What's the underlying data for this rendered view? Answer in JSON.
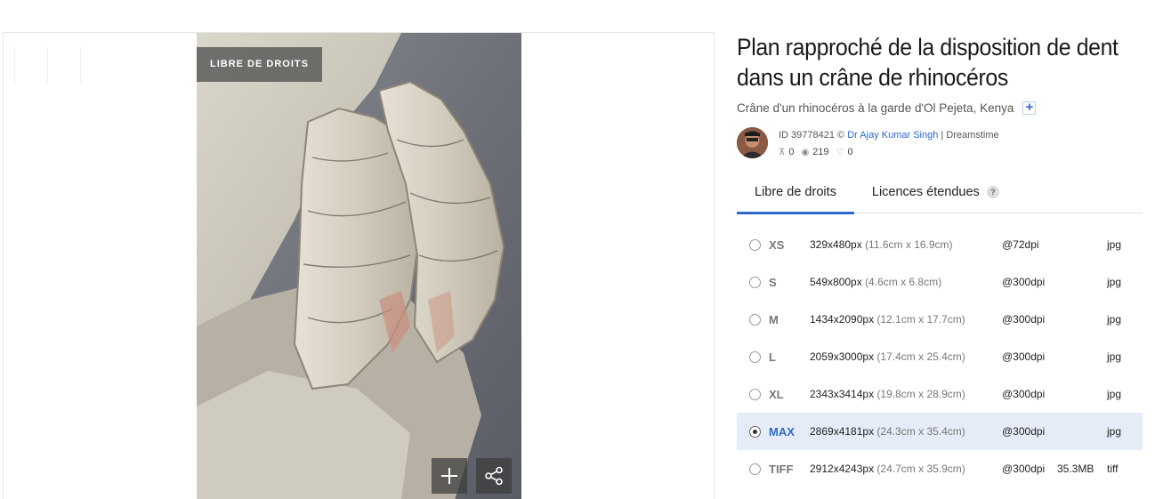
{
  "badge": "LIBRE DE DROITS",
  "title": "Plan rapproché de la disposition de dent dans un crâne de rhinocéros",
  "subtitle": "Crâne d'un rhinocéros à la garde d'Ol Pejeta, Kenya",
  "subtitle_plus": "+",
  "author": {
    "id_text": "ID 39778421 ©",
    "name": "Dr Ajay Kumar Singh",
    "agency": "| Dreamstime",
    "stats": {
      "downloads": "0",
      "views": "219",
      "likes": "0"
    }
  },
  "tabs": [
    {
      "label": "Libre de droits"
    },
    {
      "label": "Licences étendues",
      "help": "?"
    }
  ],
  "sizes": [
    {
      "name": "XS",
      "px": "329x480px",
      "cm": "(11.6cm x 16.9cm)",
      "dpi": "@72dpi",
      "mb": "",
      "format": "jpg"
    },
    {
      "name": "S",
      "px": "549x800px",
      "cm": "(4.6cm x 6.8cm)",
      "dpi": "@300dpi",
      "mb": "",
      "format": "jpg"
    },
    {
      "name": "M",
      "px": "1434x2090px",
      "cm": "(12.1cm x 17.7cm)",
      "dpi": "@300dpi",
      "mb": "",
      "format": "jpg"
    },
    {
      "name": "L",
      "px": "2059x3000px",
      "cm": "(17.4cm x 25.4cm)",
      "dpi": "@300dpi",
      "mb": "",
      "format": "jpg"
    },
    {
      "name": "XL",
      "px": "2343x3414px",
      "cm": "(19.8cm x 28.9cm)",
      "dpi": "@300dpi",
      "mb": "",
      "format": "jpg"
    },
    {
      "name": "MAX",
      "px": "2869x4181px",
      "cm": "(24.3cm x 35.4cm)",
      "dpi": "@300dpi",
      "mb": "",
      "format": "jpg",
      "selected": true
    },
    {
      "name": "TIFF",
      "px": "2912x4243px",
      "cm": "(24.7cm x 35.9cm)",
      "dpi": "@300dpi",
      "mb": "35.3MB",
      "format": "tiff"
    }
  ],
  "colors": {
    "accent": "#2e69c8",
    "selected_row": "#e5ecf7"
  },
  "icons": [
    "zoom-plus-icon",
    "share-icon",
    "downloads-icon",
    "views-icon",
    "likes-icon",
    "help-icon"
  ]
}
